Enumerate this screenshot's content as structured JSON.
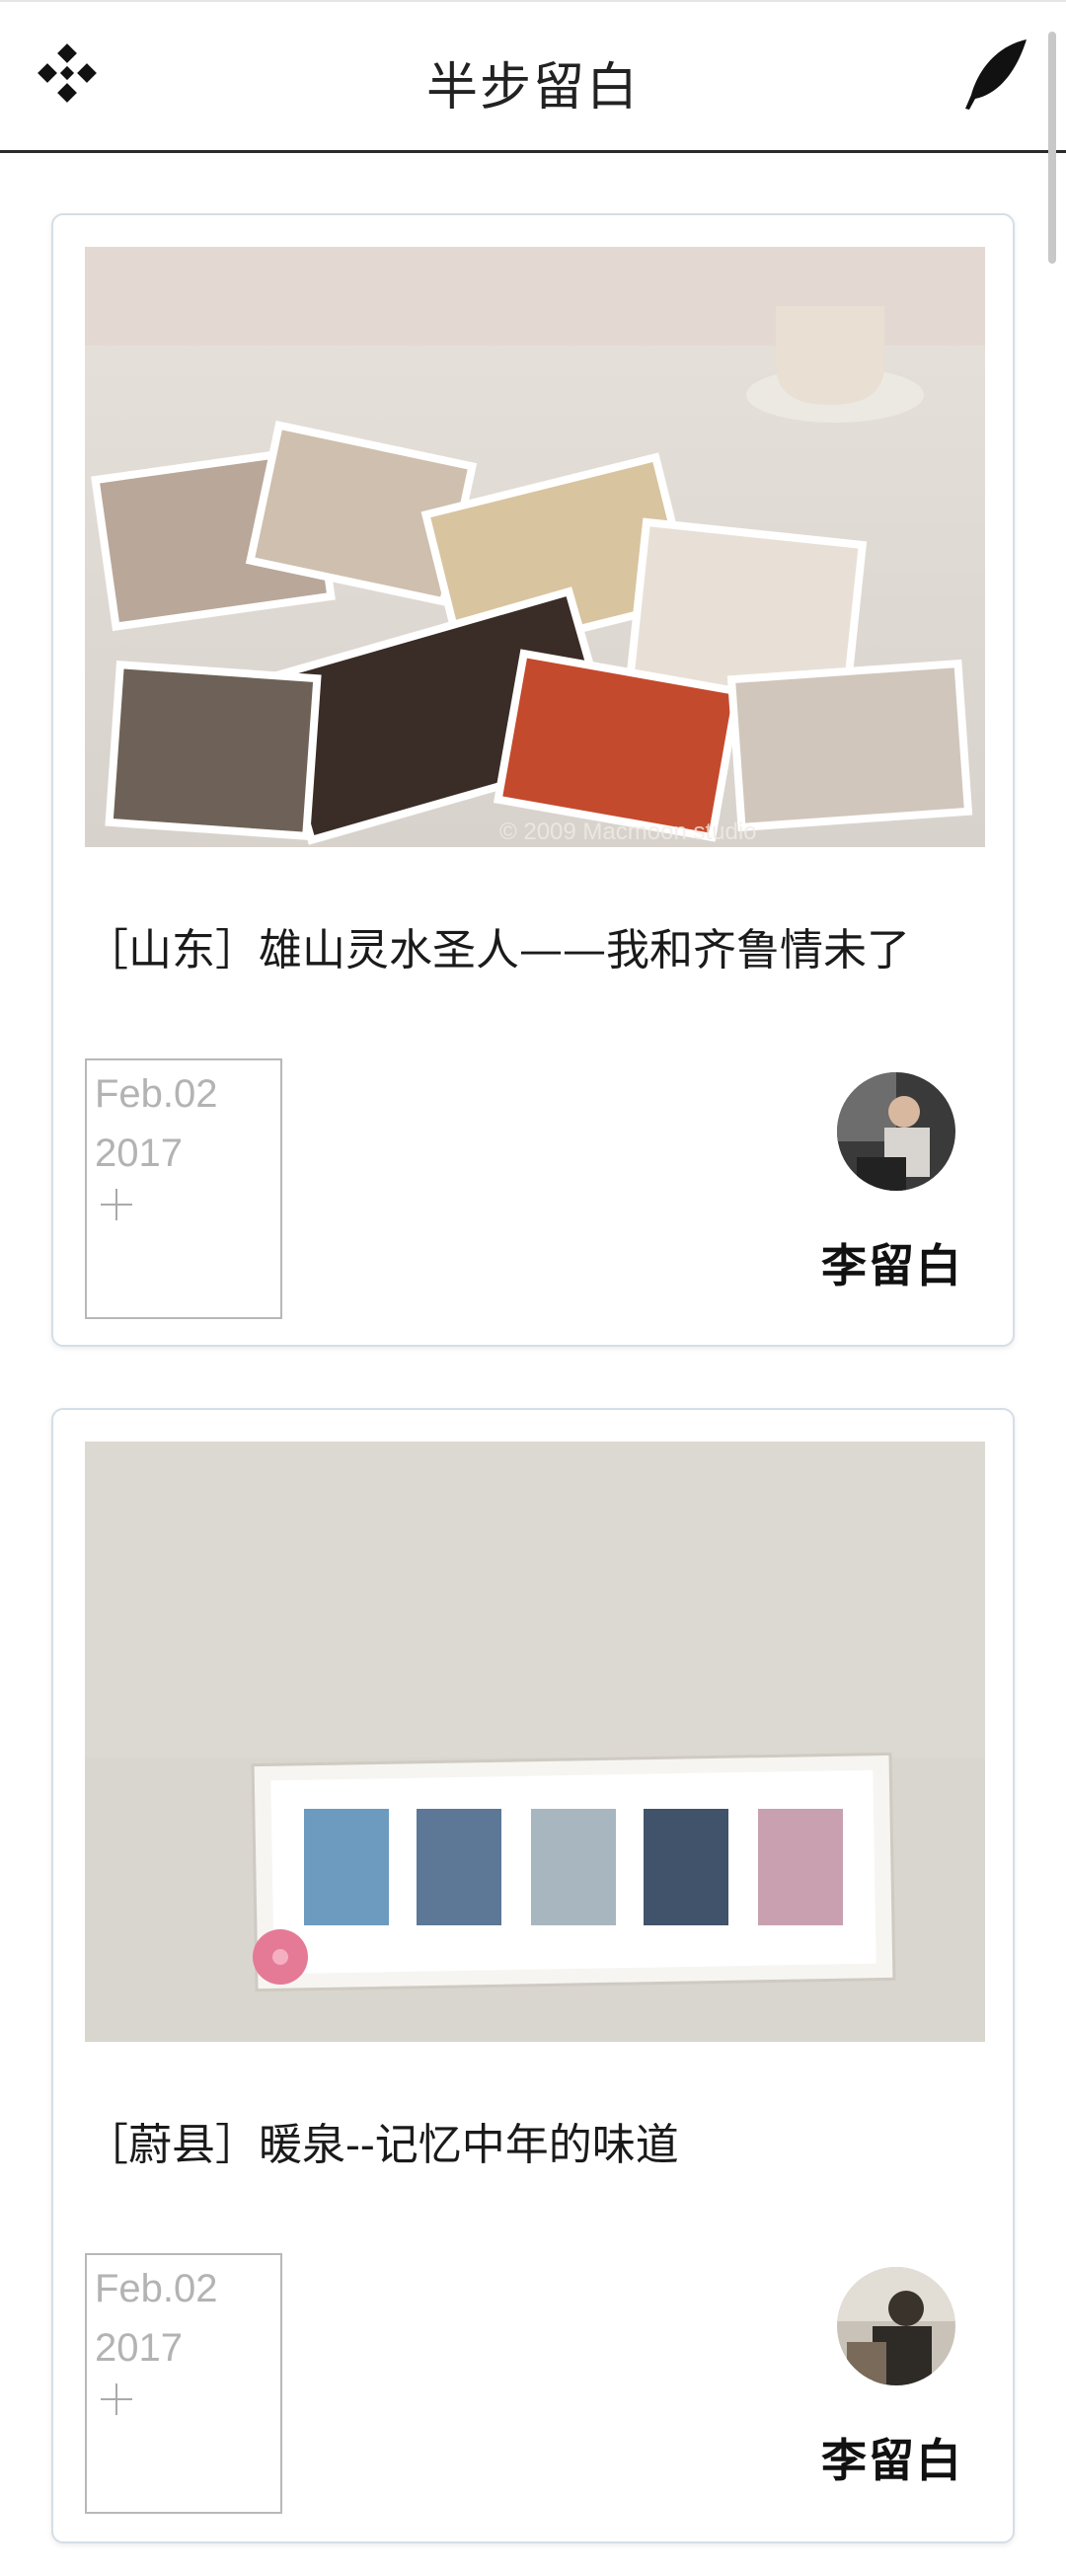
{
  "header": {
    "title": "半步留白",
    "menu_icon": "diamond-dots-icon",
    "write_icon": "feather-quill-icon"
  },
  "posts": [
    {
      "title": "［山东］雄山灵水圣人——我和齐鲁情未了",
      "date_md": "Feb.02",
      "date_year": "2017",
      "author": "李留白",
      "cover_watermark": "© 2009 Macmoon studio"
    },
    {
      "title": "［蔚县］暖泉--记忆中年的味道",
      "date_md": "Feb.02",
      "date_year": "2017",
      "author": "李留白"
    }
  ],
  "colors": {
    "card_border": "#d5dee6",
    "date_text": "#b3b3b3",
    "header_rule": "#2a2a2a"
  }
}
